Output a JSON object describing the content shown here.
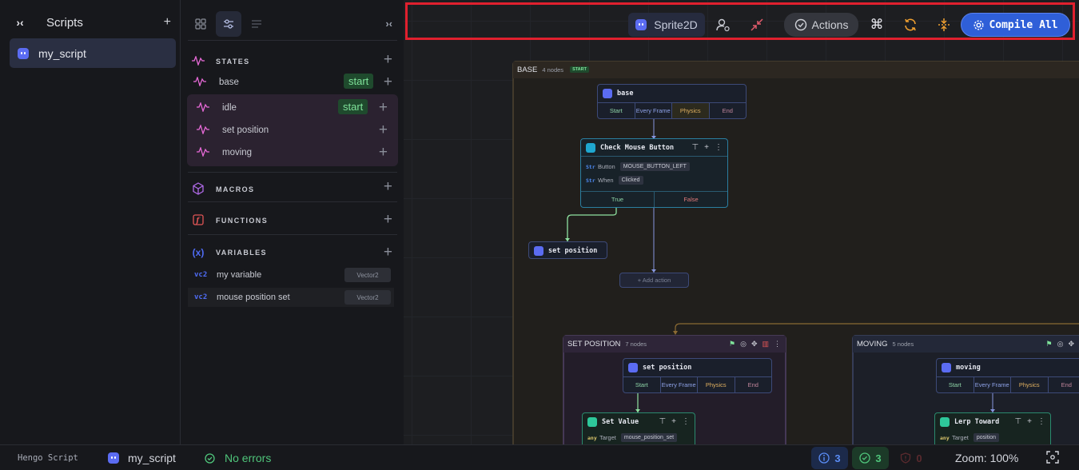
{
  "scripts_panel": {
    "title": "Scripts",
    "items": [
      {
        "label": "my_script"
      }
    ]
  },
  "mid_panel": {
    "states_title": "STATES",
    "states": [
      {
        "label": "base",
        "badge": "start"
      },
      {
        "label": "idle",
        "badge": "start"
      },
      {
        "label": "set position"
      },
      {
        "label": "moving"
      }
    ],
    "macros_title": "MACROS",
    "functions_title": "FUNCTIONS",
    "variables_title": "VARIABLES",
    "variables": [
      {
        "prefix": "vc2",
        "label": "my variable",
        "type": "Vector2"
      },
      {
        "prefix": "vc2",
        "label": "mouse position set",
        "type": "Vector2"
      }
    ]
  },
  "toolbar": {
    "sprite_label": "Sprite2D",
    "actions_label": "Actions",
    "compile_label": "Compile All",
    "accent": "#2f5fd8"
  },
  "canvas": {
    "groups": [
      {
        "name": "BASE",
        "count": "4 nodes",
        "badge": "START"
      },
      {
        "name": "SET POSITION",
        "count": "7 nodes"
      },
      {
        "name": "MOVING",
        "count": "5 nodes"
      }
    ],
    "nodes": {
      "base": {
        "title": "base",
        "tabs": [
          "Start",
          "Every Frame",
          "Physics",
          "End"
        ]
      },
      "check_mouse": {
        "title": "Check Mouse Button",
        "props": [
          {
            "type": "Str",
            "label": "Button",
            "value": "MOUSE_BUTTON_LEFT"
          },
          {
            "type": "Str",
            "label": "When",
            "value": "Clicked"
          }
        ],
        "branch_true": "True",
        "branch_false": "False"
      },
      "set_position_small": {
        "title": "set position"
      },
      "add_action": "+ Add action",
      "set_position": {
        "title": "set position",
        "tabs": [
          "Start",
          "Every Frame",
          "Physics",
          "End"
        ]
      },
      "set_value": {
        "title": "Set Value",
        "prop": {
          "type": "any",
          "label": "Target",
          "value": "mouse_position_set"
        }
      },
      "moving": {
        "title": "moving",
        "tabs": [
          "Start",
          "Every Frame",
          "Physics",
          "End"
        ]
      },
      "lerp": {
        "title": "Lerp Toward",
        "prop": {
          "type": "any",
          "label": "Target",
          "value": "position"
        }
      }
    }
  },
  "statusbar": {
    "app_name": "Hengo Script",
    "script_name": "my_script",
    "errors_text": "No errors",
    "info_count": "3",
    "ok_count": "3",
    "warn_count": "0",
    "zoom": "Zoom: 100%"
  }
}
